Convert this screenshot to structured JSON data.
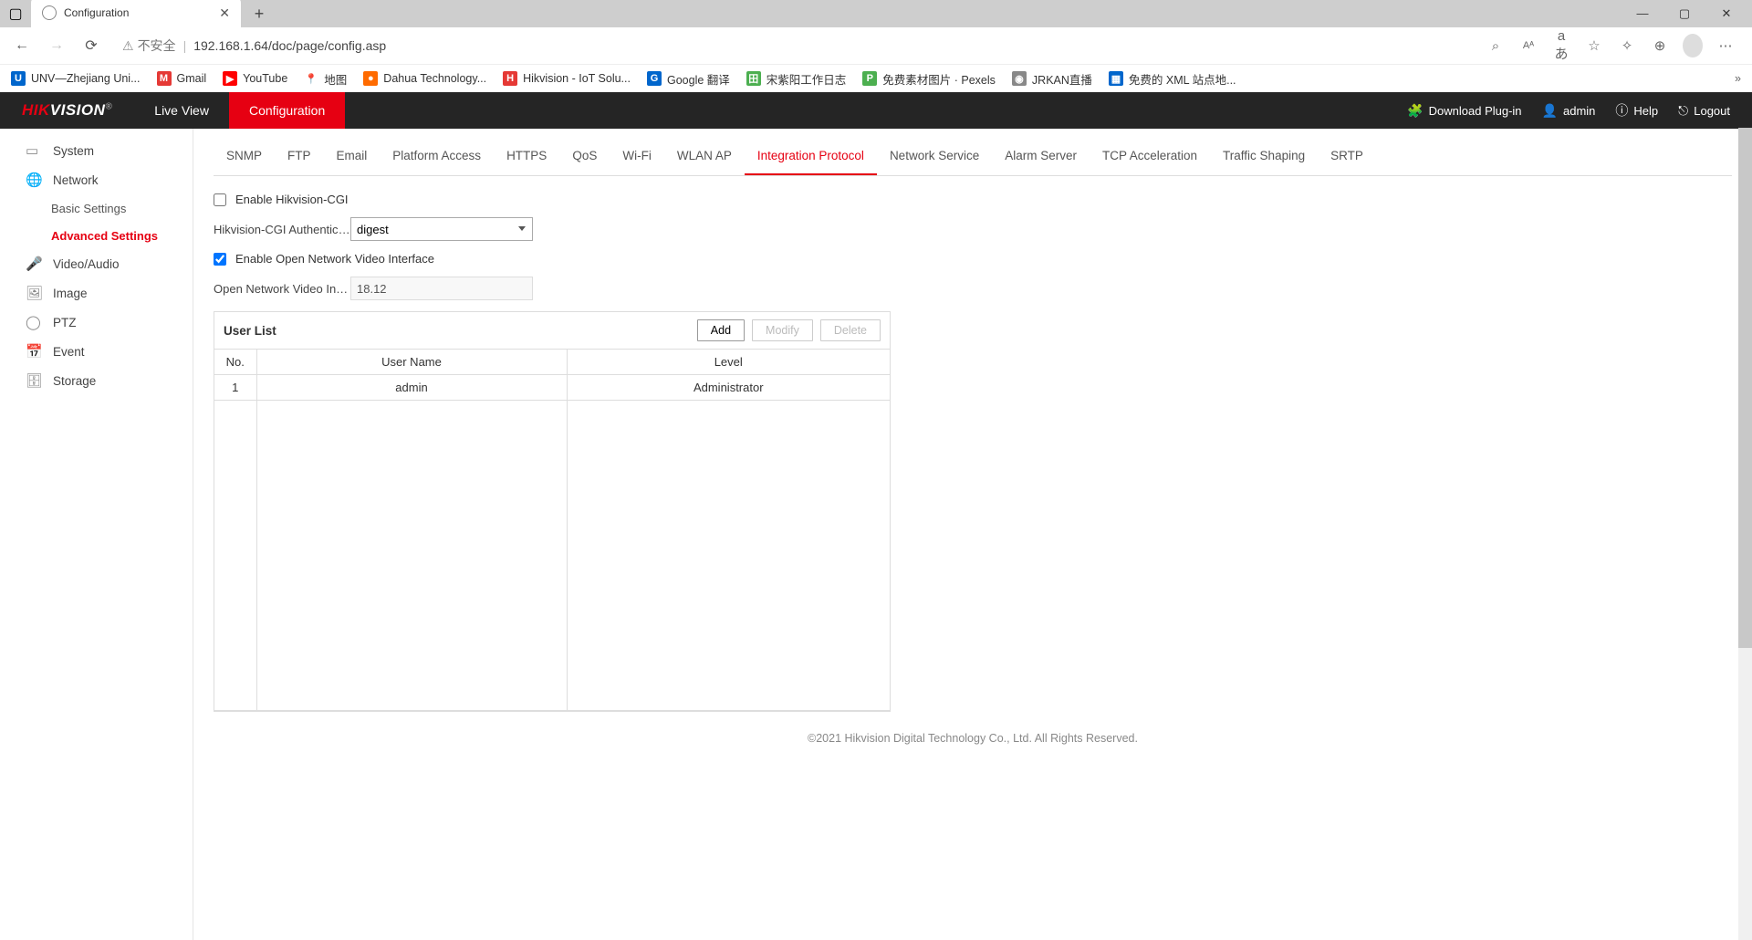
{
  "browser": {
    "tab_title": "Configuration",
    "url_insecure_label": "不安全",
    "url": "192.168.1.64/doc/page/config.asp",
    "bookmarks": [
      {
        "label": "UNV—Zhejiang Uni...",
        "icon": "U",
        "cls": "bm-blue"
      },
      {
        "label": "Gmail",
        "icon": "M",
        "cls": "bm-red"
      },
      {
        "label": "YouTube",
        "icon": "▶",
        "cls": "bm-yt"
      },
      {
        "label": "地图",
        "icon": "📍",
        "cls": ""
      },
      {
        "label": "Dahua Technology...",
        "icon": "●",
        "cls": "bm-orange"
      },
      {
        "label": "Hikvision - IoT Solu...",
        "icon": "H",
        "cls": "bm-red"
      },
      {
        "label": "Google 翻译",
        "icon": "G",
        "cls": "bm-blue"
      },
      {
        "label": "宋紫阳工作日志",
        "icon": "田",
        "cls": "bm-green"
      },
      {
        "label": "免费素材图片 · Pexels",
        "icon": "P",
        "cls": "bm-green"
      },
      {
        "label": "JRKAN直播",
        "icon": "◉",
        "cls": "bm-gray"
      },
      {
        "label": "免费的 XML 站点地...",
        "icon": "▦",
        "cls": "bm-blue"
      }
    ]
  },
  "header": {
    "logo_hik": "HIK",
    "logo_vision": "VISION",
    "logo_reg": "®",
    "nav": [
      {
        "label": "Live View",
        "active": false
      },
      {
        "label": "Configuration",
        "active": true
      }
    ],
    "right": {
      "download_plugin": "Download Plug-in",
      "user": "admin",
      "help": "Help",
      "logout": "Logout"
    }
  },
  "sidebar": {
    "items": [
      {
        "label": "System",
        "icon": "▭"
      },
      {
        "label": "Network",
        "icon": "🌐",
        "expanded": true,
        "children": [
          {
            "label": "Basic Settings",
            "active": false
          },
          {
            "label": "Advanced Settings",
            "active": true
          }
        ]
      },
      {
        "label": "Video/Audio",
        "icon": "🎤"
      },
      {
        "label": "Image",
        "icon": "🖼"
      },
      {
        "label": "PTZ",
        "icon": "◯"
      },
      {
        "label": "Event",
        "icon": "📅"
      },
      {
        "label": "Storage",
        "icon": "🗄"
      }
    ]
  },
  "subtabs": [
    "SNMP",
    "FTP",
    "Email",
    "Platform Access",
    "HTTPS",
    "QoS",
    "Wi-Fi",
    "WLAN AP",
    "Integration Protocol",
    "Network Service",
    "Alarm Server",
    "TCP Acceleration",
    "Traffic Shaping",
    "SRTP"
  ],
  "subtab_active_index": 8,
  "form": {
    "enable_cgi_label": "Enable Hikvision-CGI",
    "enable_cgi_checked": false,
    "auth_label": "Hikvision-CGI Authenticat...",
    "auth_value": "digest",
    "enable_onvif_label": "Enable Open Network Video Interface",
    "enable_onvif_checked": true,
    "onvif_ver_label": "Open Network Video Inter...",
    "onvif_ver_value": "18.12"
  },
  "user_list": {
    "title": "User List",
    "buttons": {
      "add": "Add",
      "modify": "Modify",
      "delete": "Delete"
    },
    "columns": {
      "no": "No.",
      "user": "User Name",
      "level": "Level"
    },
    "rows": [
      {
        "no": "1",
        "user": "admin",
        "level": "Administrator"
      }
    ]
  },
  "footer": "©2021 Hikvision Digital Technology Co., Ltd. All Rights Reserved."
}
